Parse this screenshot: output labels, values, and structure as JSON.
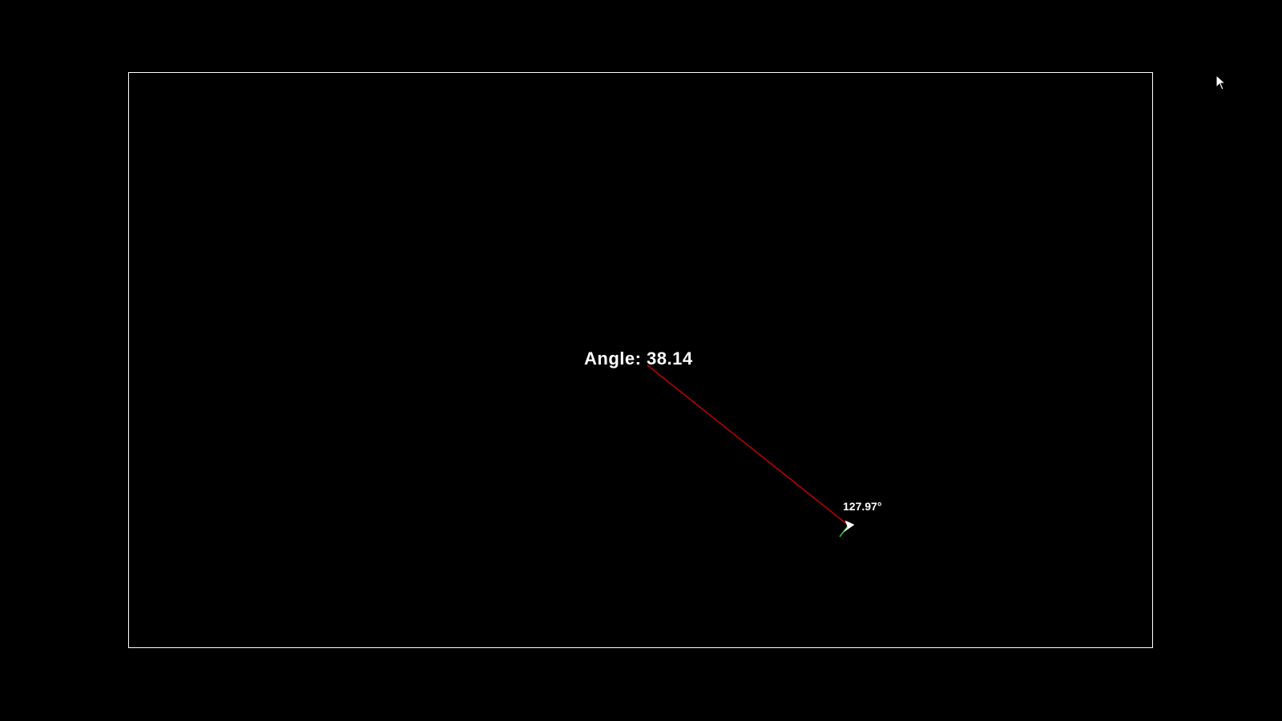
{
  "angle_label": "Angle: 38.14",
  "heading_readout": "127.97°",
  "colors": {
    "background": "#000000",
    "frame": "#ffffff",
    "line": "#c00000",
    "marker_arrow": "#ffffff",
    "marker_tail": "#33cc33",
    "text": "#ffffff"
  },
  "icons": {
    "cursor": "mouse-pointer-icon",
    "marker": "direction-arrow-icon"
  }
}
